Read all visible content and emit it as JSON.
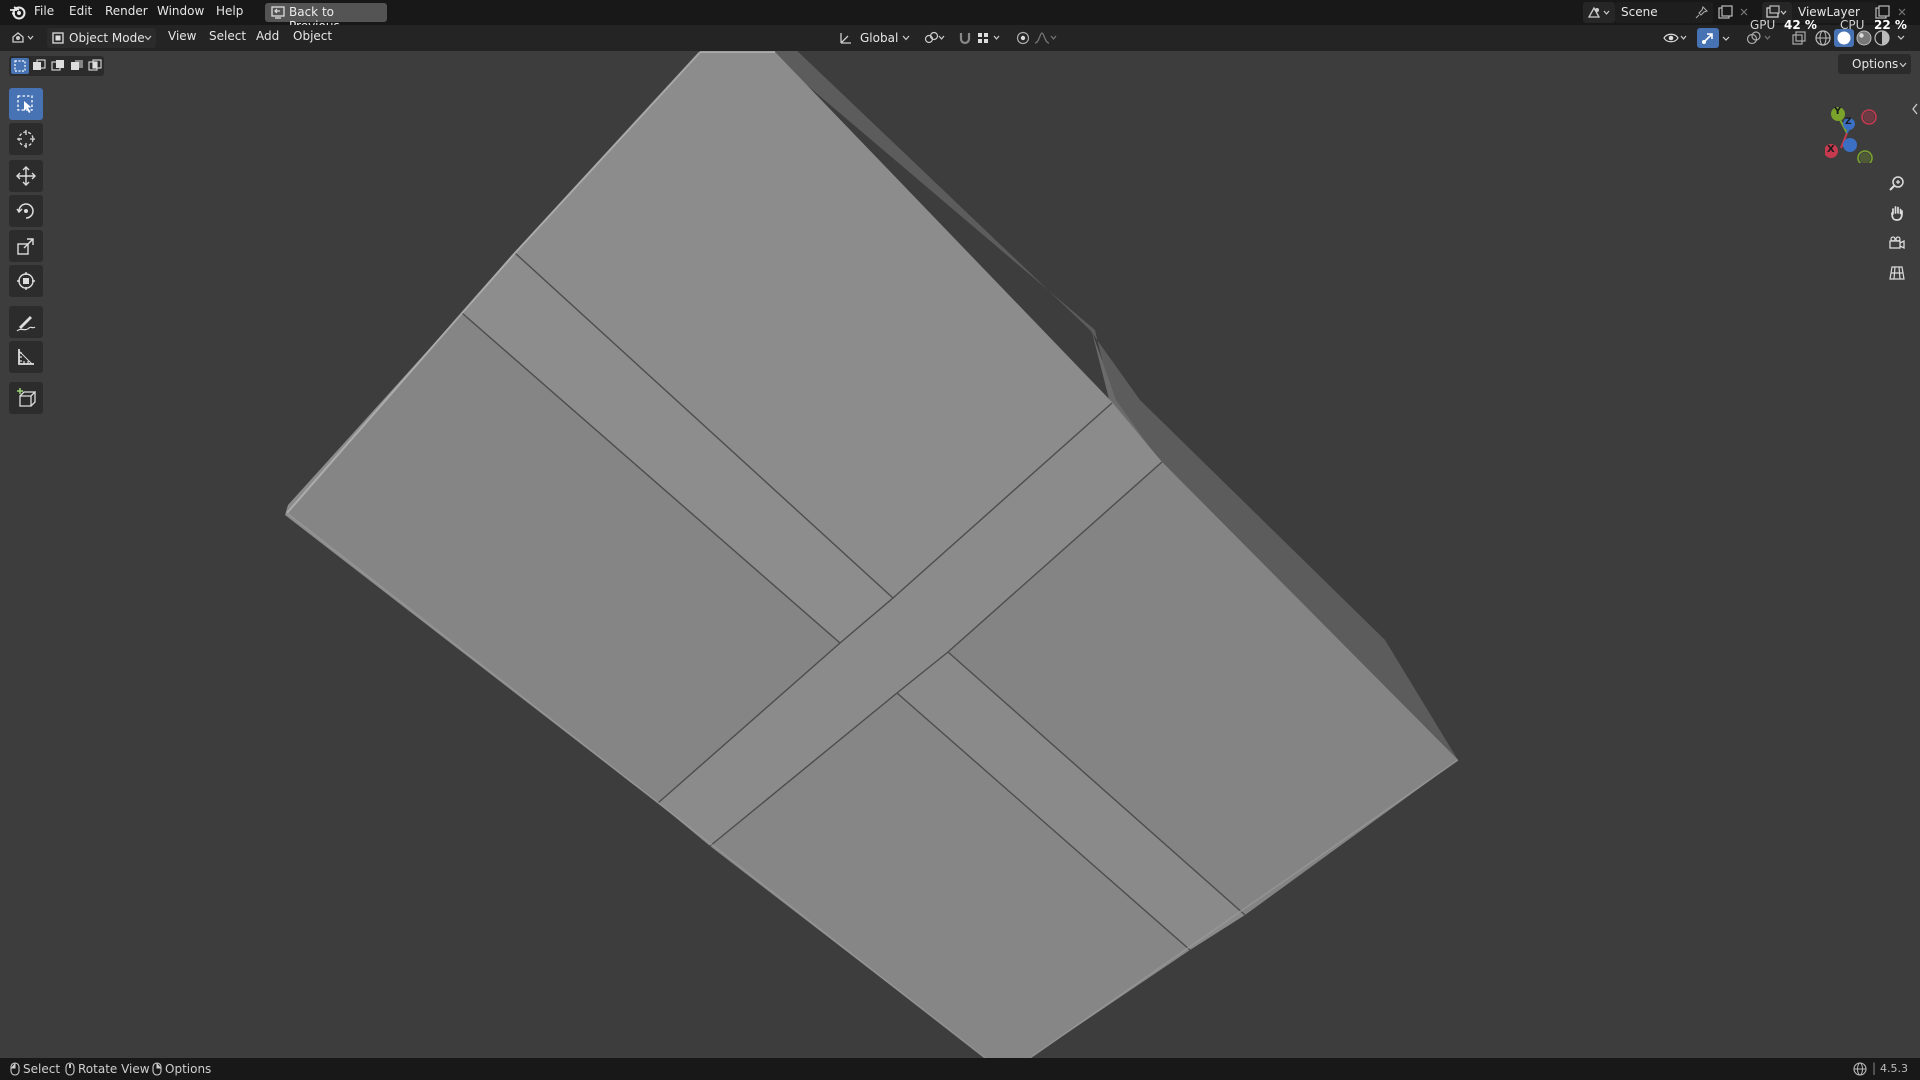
{
  "topbar": {
    "menus": [
      "File",
      "Edit",
      "Render",
      "Window",
      "Help"
    ],
    "back_button": "Back to Previous",
    "scene": "Scene",
    "view_layer": "ViewLayer"
  },
  "header": {
    "mode": "Object Mode",
    "menus": [
      "View",
      "Select",
      "Add",
      "Object"
    ],
    "transform_orientation": "Global",
    "options_label": "Options"
  },
  "stats": {
    "gpu_label": "GPU",
    "gpu_value": "42 %",
    "cpu_label": "CPU",
    "cpu_value": "22 %"
  },
  "gizmo": {
    "y_label": "Y",
    "z_label": "Z",
    "x_label": "X"
  },
  "statusbar": {
    "select": "Select",
    "rotate": "Rotate View",
    "options": "Options",
    "version": "4.5.3"
  },
  "colors": {
    "accent": "#4772b3",
    "axis_x": "#c53a4f",
    "axis_y": "#7aa32c",
    "axis_z": "#3a6fc4"
  },
  "icons": [
    "blender-logo",
    "select-box-icon",
    "cursor-icon",
    "move-icon",
    "rotate-icon",
    "scale-icon",
    "transform-icon",
    "annotate-icon",
    "measure-icon",
    "add-cube-icon",
    "zoom-icon",
    "hand-pan-icon",
    "camera-icon",
    "grid-icon"
  ]
}
